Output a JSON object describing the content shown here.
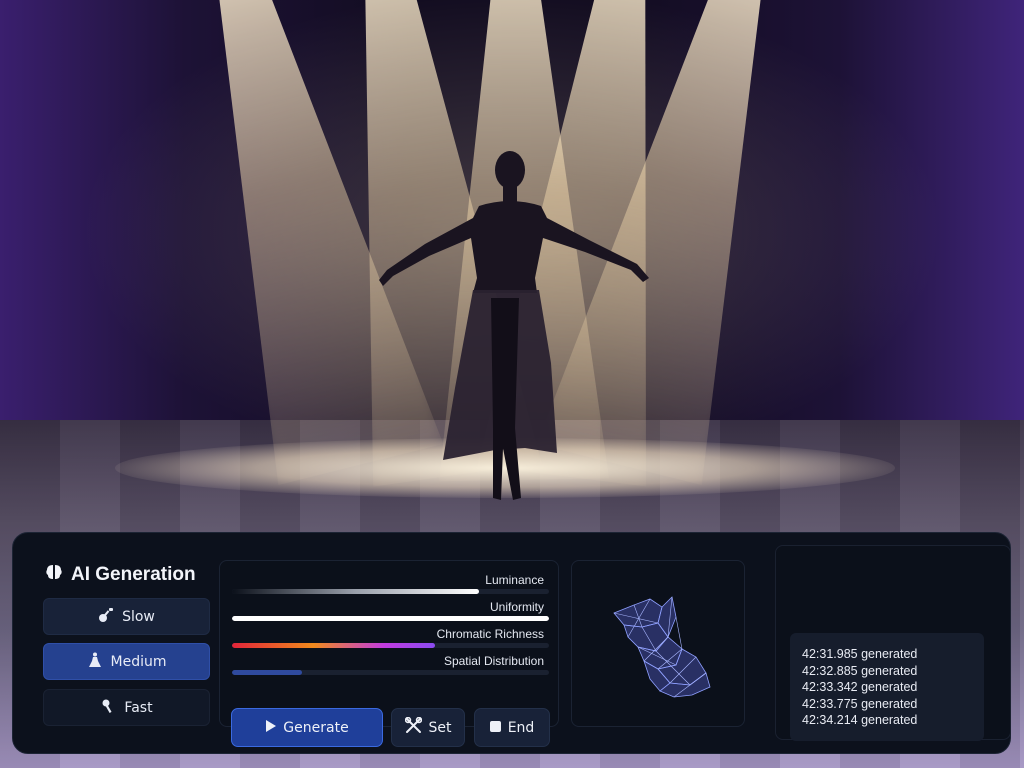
{
  "panel": {
    "title": "AI Generation",
    "speeds": [
      {
        "label": "Slow",
        "icon": "guitar-icon",
        "state": "normal"
      },
      {
        "label": "Medium",
        "icon": "dancer-icon",
        "state": "active"
      },
      {
        "label": "Fast",
        "icon": "microphone-icon",
        "state": "dim"
      }
    ]
  },
  "metrics": [
    {
      "label": "Luminance",
      "level": 0.78,
      "color": "gradient-gray-white"
    },
    {
      "label": "Uniformity",
      "level": 1.0,
      "color": "#ffffff"
    },
    {
      "label": "Chromatic Richness",
      "level": 0.64,
      "color": "gradient-red-orange-purple"
    },
    {
      "label": "Spatial Distribution",
      "level": 0.22,
      "color": "#2f4a9e"
    }
  ],
  "actions": {
    "generate": "Generate",
    "set": "Set",
    "end": "End"
  },
  "log": {
    "entries": [
      "42:31.985 generated",
      "42:32.885 generated",
      "42:33.342 generated",
      "42:33.775 generated",
      "42:34.214 generated"
    ]
  },
  "colors": {
    "accent": "#3b6ae0",
    "active_button": "#25418f",
    "panel_bg": "#0c111c"
  }
}
